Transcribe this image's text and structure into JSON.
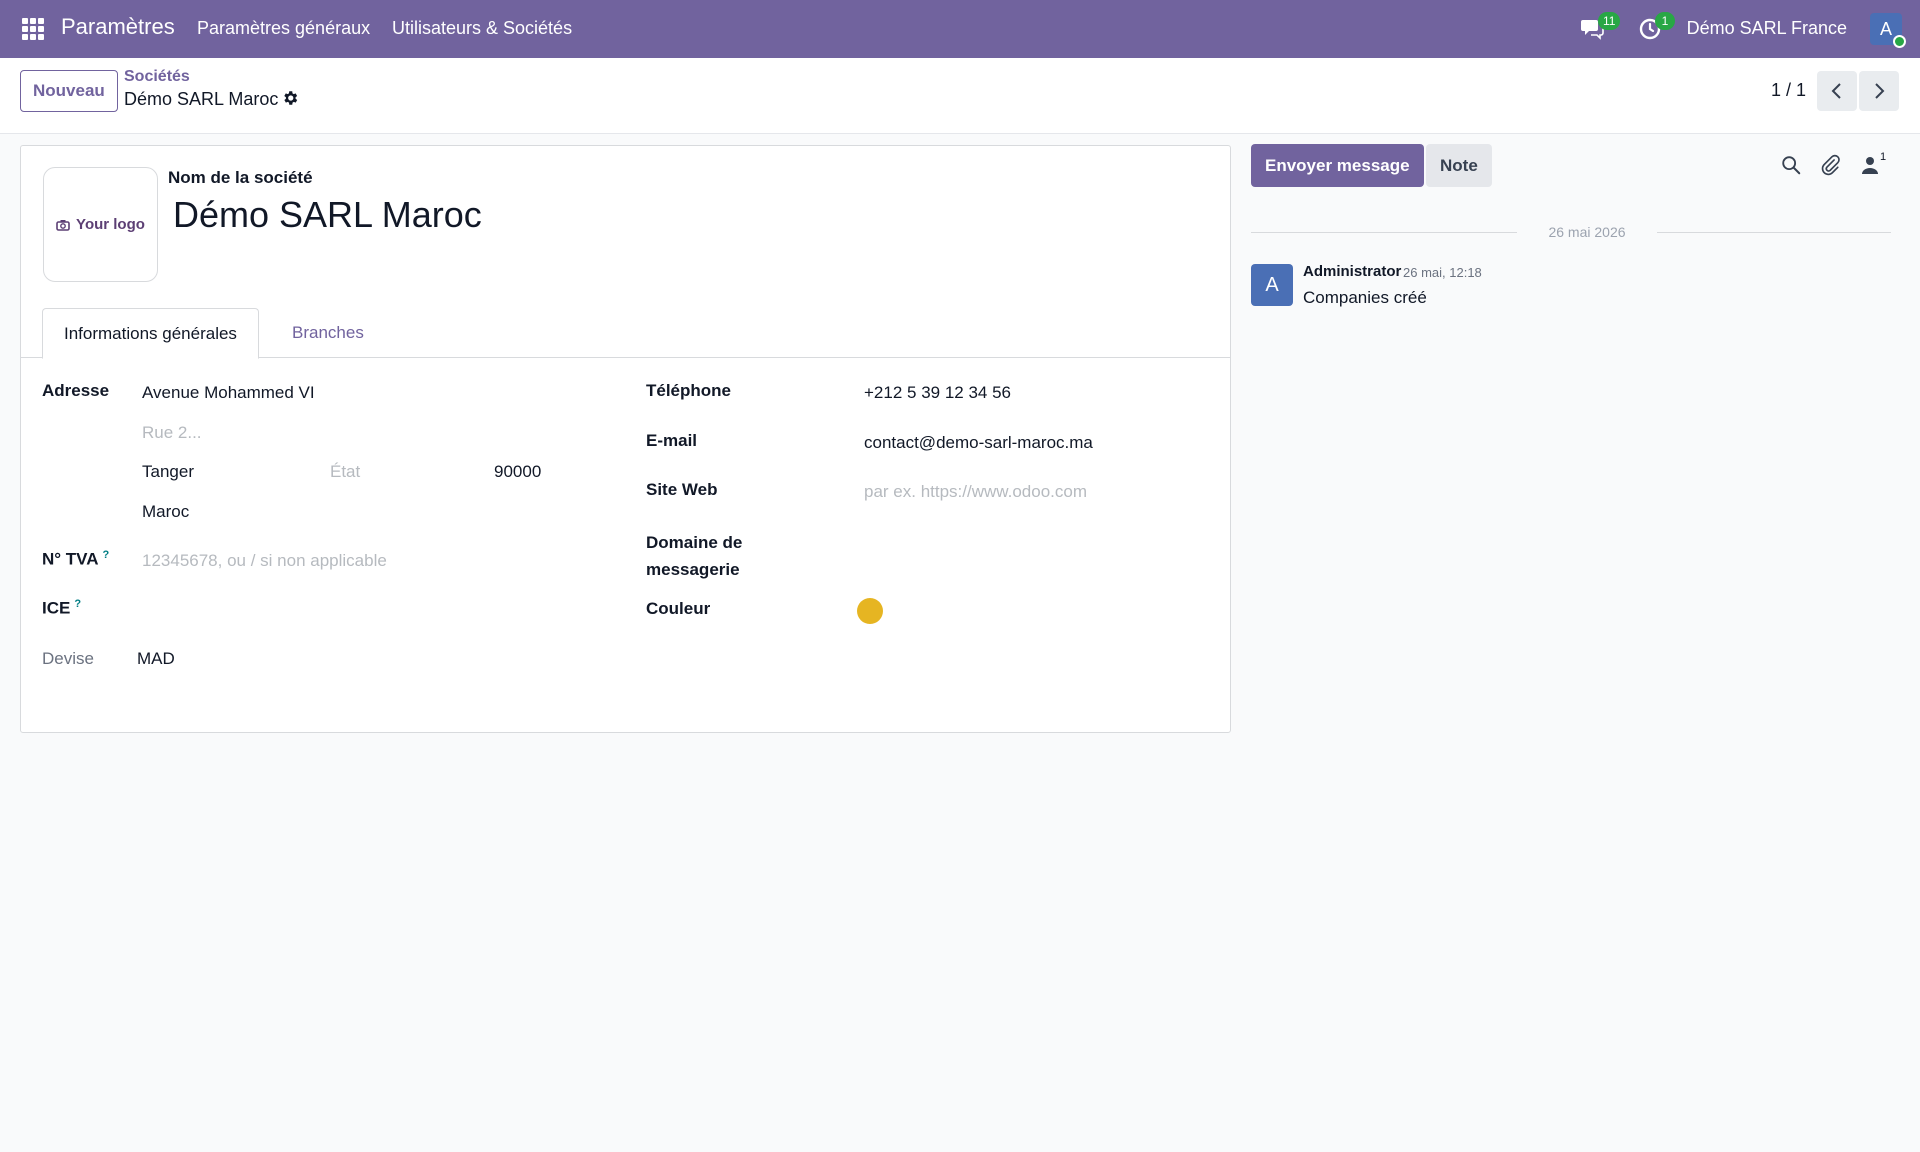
{
  "navbar": {
    "app_title": "Paramètres",
    "menu": [
      "Paramètres généraux",
      "Utilisateurs & Sociétés"
    ],
    "messages_count": "11",
    "activities_count": "1",
    "company": "Démo SARL France",
    "user_initial": "A"
  },
  "control_panel": {
    "new_button": "Nouveau",
    "breadcrumb_parent": "Sociétés",
    "breadcrumb_current": "Démo SARL Maroc",
    "pager": "1 / 1"
  },
  "form": {
    "logo_placeholder": "Your logo",
    "name_label": "Nom de la société",
    "name_value": "Démo SARL Maroc",
    "tabs": [
      "Informations générales",
      "Branches"
    ],
    "left": {
      "address_label": "Adresse",
      "street": "Avenue Mohammed VI",
      "street2_placeholder": "Rue 2...",
      "city": "Tanger",
      "state_placeholder": "État",
      "zip": "90000",
      "country": "Maroc",
      "vat_label": "N° TVA",
      "vat_placeholder": "12345678, ou / si non applicable",
      "ice_label": "ICE",
      "help_mark": "?",
      "currency_label": "Devise",
      "currency_value": "MAD"
    },
    "right": {
      "phone_label": "Téléphone",
      "phone_value": "+212 5 39 12 34 56",
      "email_label": "E-mail",
      "email_value": "contact@demo-sarl-maroc.ma",
      "website_label": "Site Web",
      "website_placeholder": "par ex. https://www.odoo.com",
      "mail_domain_label_1": "Domaine de",
      "mail_domain_label_2": "messagerie",
      "color_label": "Couleur",
      "color_value": "#e6b522"
    }
  },
  "chatter": {
    "send_message": "Envoyer message",
    "note": "Note",
    "followers_count": "1",
    "date_separator": "26 mai 2026",
    "message": {
      "avatar_initial": "A",
      "author": "Administrator",
      "date": "26 mai, 12:18",
      "body": "Companies créé"
    }
  },
  "colors": {
    "brand": "#71639e",
    "avatar": "#4a6fb5",
    "badge": "#28a745"
  }
}
